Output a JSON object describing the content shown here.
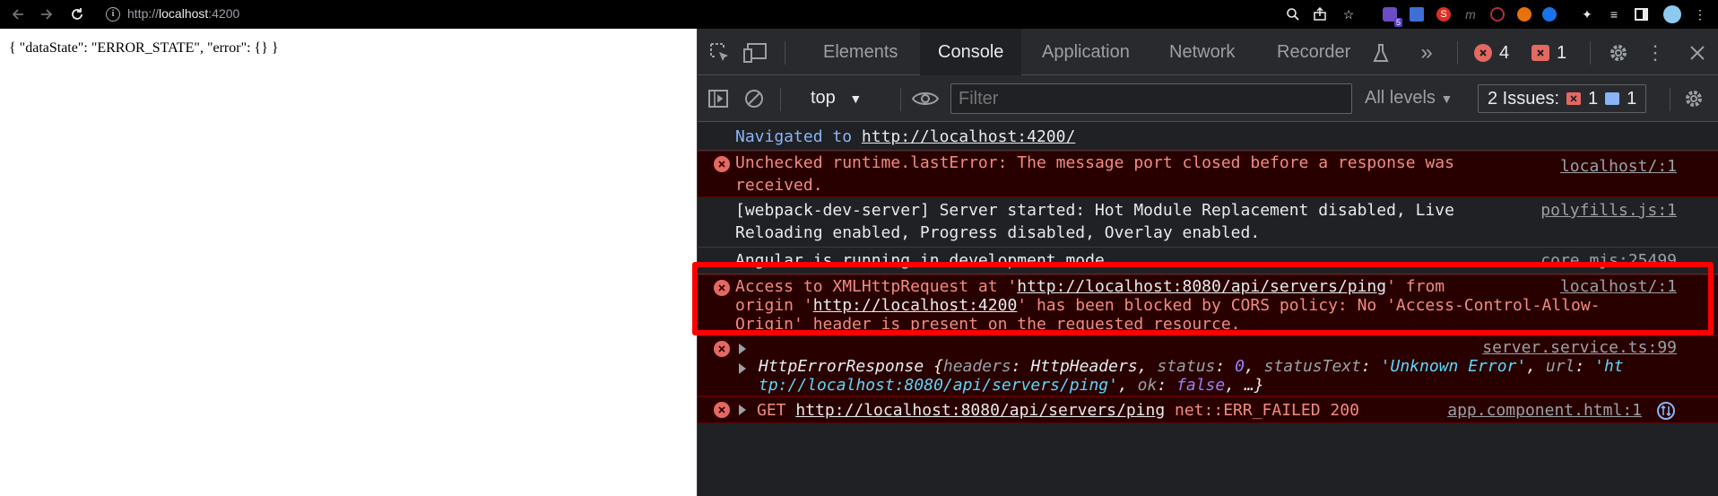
{
  "browser": {
    "url_prefix": "http://",
    "url_host": "localhost",
    "url_port": ":4200"
  },
  "page": {
    "content": "{ \"dataState\": \"ERROR_STATE\", \"error\": {} }"
  },
  "devtools": {
    "tabs": [
      "Elements",
      "Console",
      "Application",
      "Network",
      "Recorder"
    ],
    "active_tab": "Console",
    "error_count": "4",
    "issue_count": "1",
    "context": "top",
    "filter_placeholder": "Filter",
    "levels": "All levels",
    "issues_label": "2 Issues:",
    "issues_red": "1",
    "issues_blue": "1"
  },
  "console": {
    "navigated_prefix": "Navigated to ",
    "navigated_url": "http://localhost:4200/",
    "msg1_line1": "Unchecked runtime.lastError: The message port closed before a response was",
    "msg1_line2": "received.",
    "msg1_src": "localhost/:1",
    "msg2_line1": "[webpack-dev-server] Server started: Hot Module Replacement disabled, Live",
    "msg2_line2": "Reloading enabled, Progress disabled, Overlay enabled.",
    "msg2_src": "polyfills.js:1",
    "msg3_text": "Angular is running in development mode.",
    "msg3_src": "core.mjs:25499",
    "cors_a": "Access to XMLHttpRequest at '",
    "cors_url1": "http://localhost:8080/api/servers/ping",
    "cors_b": "' from",
    "cors_c": "origin '",
    "cors_url2": "http://localhost:4200",
    "cors_d": "' has been blocked by CORS policy: No 'Access-Control-Allow-",
    "cors_e": "Origin' header is present on the requested resource.",
    "cors_src": "localhost/:1",
    "resp_src": "server.service.ts:99",
    "resp_name": "HttpErrorResponse {",
    "resp_k1": "headers",
    "resp_v1": "HttpHeaders",
    "resp_k2": "status",
    "resp_v2": "0",
    "resp_k3": "statusText",
    "resp_v3": "'Unknown Error'",
    "resp_k4": "url",
    "resp_v4a": "'ht",
    "resp_v4b": "tp://localhost:8080/api/servers/ping'",
    "resp_k5": "ok",
    "resp_v5": "false",
    "resp_end": ", …}",
    "get_method": "GET ",
    "get_url": "http://localhost:8080/api/servers/ping",
    "get_status": " net::ERR_FAILED 200",
    "get_src": "app.component.html:1"
  }
}
